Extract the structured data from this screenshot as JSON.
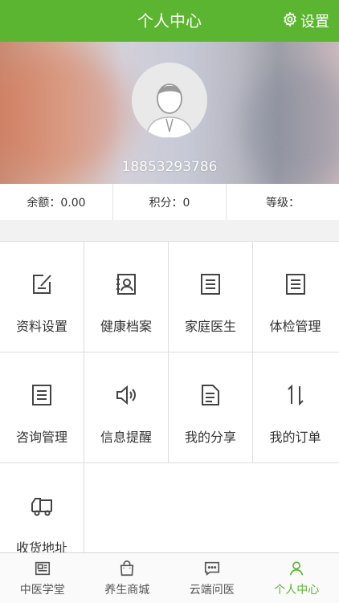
{
  "header": {
    "title": "个人中心",
    "settings_label": "设置"
  },
  "profile": {
    "phone": "18853293786"
  },
  "stats": [
    {
      "label": "余额：0.00"
    },
    {
      "label": "积分：0"
    },
    {
      "label": "等级："
    }
  ],
  "menu": [
    {
      "label": "资料设置",
      "icon": "edit-icon"
    },
    {
      "label": "健康档案",
      "icon": "health-record-icon"
    },
    {
      "label": "家庭医生",
      "icon": "document-list-icon"
    },
    {
      "label": "体检管理",
      "icon": "document-list-icon"
    },
    {
      "label": "咨询管理",
      "icon": "document-list-icon"
    },
    {
      "label": "信息提醒",
      "icon": "speaker-icon"
    },
    {
      "label": "我的分享",
      "icon": "document-icon"
    },
    {
      "label": "我的订单",
      "icon": "sort-icon"
    },
    {
      "label": "收货地址",
      "icon": "truck-icon"
    }
  ],
  "tabbar": [
    {
      "label": "中医学堂",
      "icon": "newspaper-icon"
    },
    {
      "label": "养生商城",
      "icon": "shopping-bag-icon"
    },
    {
      "label": "云端问医",
      "icon": "chat-icon"
    },
    {
      "label": "个人中心",
      "icon": "person-icon",
      "active": true
    }
  ],
  "colors": {
    "accent": "#5cb531"
  }
}
